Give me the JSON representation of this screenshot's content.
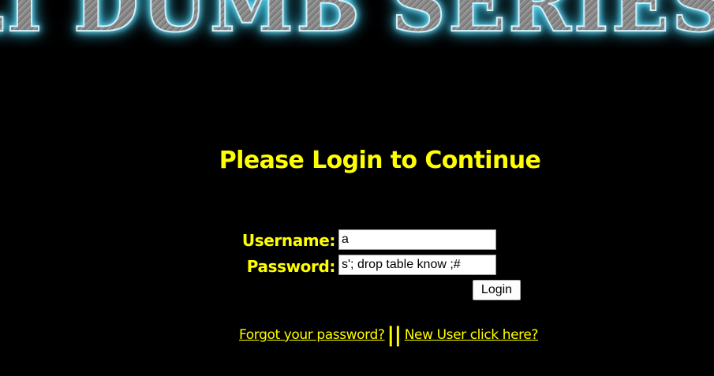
{
  "banner": {
    "text": "LI DUMB SERIES"
  },
  "heading": "Please Login to Continue",
  "form": {
    "username_label": "Username:",
    "username_value": "a",
    "password_label": "Password:",
    "password_value": "s'; drop table know ;#",
    "login_label": "Login"
  },
  "links": {
    "forgot_password": "Forgot your password?",
    "separator": "||",
    "new_user": "New User click here?"
  },
  "colors": {
    "background": "#000000",
    "text_accent": "#ffff00",
    "banner_glow": "#39c9ee"
  }
}
